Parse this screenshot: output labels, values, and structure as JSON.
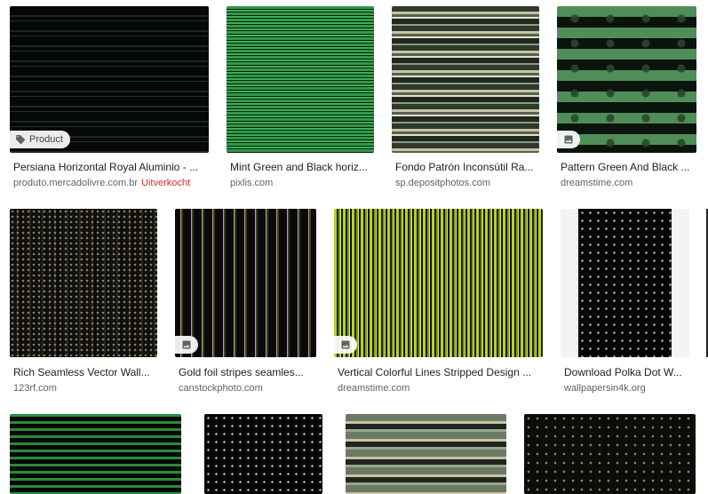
{
  "results": [
    {
      "title": "Persiana Horizontal Royal Aluminio - ...",
      "source": "produto.mercadolivre.com.br",
      "status": "Uitverkocht",
      "badge": "Product",
      "badge_icon": "tag-icon",
      "texture": "dark horizontal stripes"
    },
    {
      "title": "Mint Green and Black horiz...",
      "source": "pixlis.com",
      "texture": "green horizontal stripes"
    },
    {
      "title": "Fondo Patrón Inconsútil Ra...",
      "source": "sp.depositphotos.com",
      "texture": "tan horizontal stripes"
    },
    {
      "title": "Pattern Green And Black ...",
      "source": "dreamstime.com",
      "badge_icon": "image-icon",
      "texture": "green and black pattern"
    },
    {
      "title": "Rich Seamless Vector Wall...",
      "source": "123rf.com",
      "texture": "dotted vertical stripes"
    },
    {
      "title": "Gold foil stripes seamles...",
      "source": "canstockphoto.com",
      "badge_icon": "image-icon",
      "texture": "gold vertical stripes"
    },
    {
      "title": "Vertical Colorful Lines Stripped Design ...",
      "source": "dreamstime.com",
      "badge_icon": "image-icon",
      "texture": "yellow-green vertical stripes"
    },
    {
      "title": "Download Polka Dot W...",
      "source": "wallpapersin4k.org",
      "texture": "polka dot"
    },
    {
      "texture": "green stripes"
    },
    {
      "texture": "polka dot"
    },
    {
      "texture": "olive horizontal stripes"
    },
    {
      "texture": "polka dot"
    }
  ]
}
